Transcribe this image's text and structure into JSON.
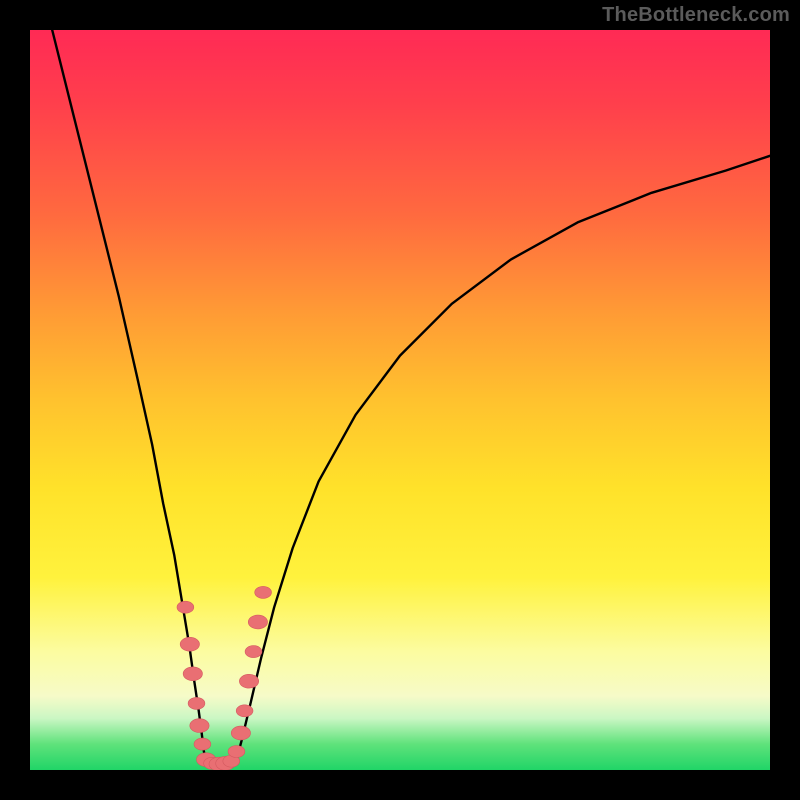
{
  "watermark": "TheBottleneck.com",
  "colors": {
    "frame": "#000000",
    "curve": "#000000",
    "marker_fill": "#e96f73",
    "marker_stroke": "#d55a60"
  },
  "chart_data": {
    "type": "line",
    "title": "",
    "xlabel": "",
    "ylabel": "",
    "xlim": [
      0,
      100
    ],
    "ylim": [
      0,
      100
    ],
    "series": [
      {
        "name": "left-branch",
        "x": [
          3,
          6,
          9,
          12,
          14.5,
          16.5,
          18,
          19.5,
          20.5,
          21.5,
          22.2,
          22.8,
          23.2,
          23.5,
          23.8
        ],
        "y": [
          100,
          88,
          76,
          64,
          53,
          44,
          36,
          29,
          23,
          17,
          12,
          8,
          5,
          2.5,
          1
        ]
      },
      {
        "name": "valley-floor",
        "x": [
          23.8,
          25.0,
          26.5,
          27.8
        ],
        "y": [
          1,
          0.6,
          0.6,
          1
        ]
      },
      {
        "name": "right-branch",
        "x": [
          27.8,
          28.6,
          29.8,
          31.2,
          33,
          35.5,
          39,
          44,
          50,
          57,
          65,
          74,
          84,
          94,
          100
        ],
        "y": [
          1,
          4,
          9,
          15,
          22,
          30,
          39,
          48,
          56,
          63,
          69,
          74,
          78,
          81,
          83
        ]
      }
    ],
    "markers": {
      "name": "cluster-near-minimum",
      "points": [
        {
          "x": 21.0,
          "y": 22,
          "r": 2.0
        },
        {
          "x": 21.6,
          "y": 17,
          "r": 2.3
        },
        {
          "x": 22.0,
          "y": 13,
          "r": 2.3
        },
        {
          "x": 22.5,
          "y": 9,
          "r": 2.0
        },
        {
          "x": 22.9,
          "y": 6,
          "r": 2.3
        },
        {
          "x": 23.3,
          "y": 3.5,
          "r": 2.0
        },
        {
          "x": 23.8,
          "y": 1.4,
          "r": 2.3
        },
        {
          "x": 24.6,
          "y": 0.9,
          "r": 2.0
        },
        {
          "x": 25.5,
          "y": 0.8,
          "r": 2.3
        },
        {
          "x": 26.4,
          "y": 0.9,
          "r": 2.3
        },
        {
          "x": 27.2,
          "y": 1.2,
          "r": 2.0
        },
        {
          "x": 27.9,
          "y": 2.5,
          "r": 2.0
        },
        {
          "x": 28.5,
          "y": 5,
          "r": 2.3
        },
        {
          "x": 29.0,
          "y": 8,
          "r": 2.0
        },
        {
          "x": 29.6,
          "y": 12,
          "r": 2.3
        },
        {
          "x": 30.2,
          "y": 16,
          "r": 2.0
        },
        {
          "x": 30.8,
          "y": 20,
          "r": 2.3
        },
        {
          "x": 31.5,
          "y": 24,
          "r": 2.0
        }
      ]
    }
  }
}
